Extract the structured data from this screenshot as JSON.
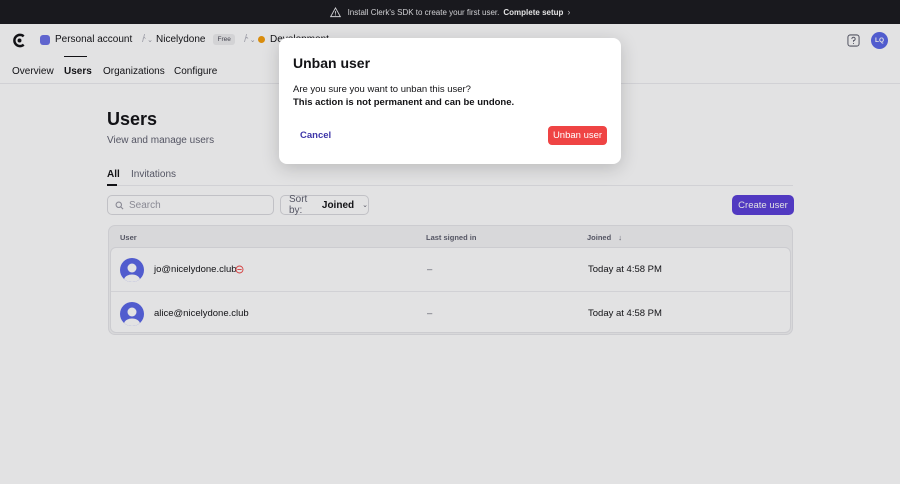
{
  "banner": {
    "message": "Install Clerk's SDK to create your first user.",
    "action": "Complete setup",
    "chevron": "›"
  },
  "header": {
    "account": "Personal account",
    "app": "Nicelydone",
    "plan_badge": "Free",
    "environment": "Development",
    "separator": "/",
    "avatar_initials": "LQ"
  },
  "nav": {
    "items": [
      "Overview",
      "Users",
      "Organizations",
      "Configure"
    ],
    "active": "Users"
  },
  "page": {
    "title": "Users",
    "subtitle": "View and manage users",
    "tabs": [
      "All",
      "Invitations"
    ],
    "active_tab": "All"
  },
  "toolbar": {
    "search_placeholder": "Search",
    "sort_label": "Sort by:",
    "sort_value": "Joined",
    "create_label": "Create user"
  },
  "table": {
    "columns": [
      "User",
      "Last signed in",
      "Joined"
    ],
    "sort_arrow": "↓",
    "rows": [
      {
        "email": "jo@nicelydone.club",
        "banned": true,
        "last_signed_in": "–",
        "joined": "Today at 4:58 PM"
      },
      {
        "email": "alice@nicelydone.club",
        "banned": false,
        "last_signed_in": "–",
        "joined": "Today at 4:58 PM"
      }
    ]
  },
  "modal": {
    "title": "Unban user",
    "question": "Are you sure you want to unban this user?",
    "warning": "This action is not permanent and can be undone.",
    "cancel_label": "Cancel",
    "confirm_label": "Unban user"
  },
  "colors": {
    "primary": "#5b3fd9",
    "danger": "#ef4444",
    "banner_bg": "#1b1b1f",
    "avatar": "#5b67e8",
    "env_dot": "#f59e0b"
  }
}
